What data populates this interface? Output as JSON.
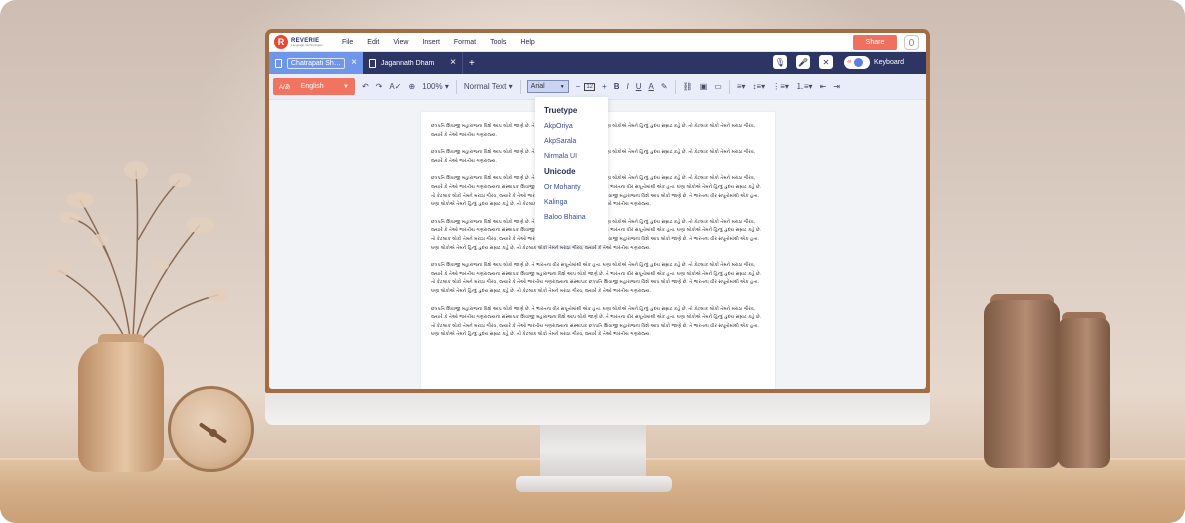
{
  "app": {
    "logo": {
      "name": "REVERIE",
      "tagline": "Language Technologies"
    },
    "menu": [
      "File",
      "Edit",
      "View",
      "Insert",
      "Format",
      "Tools",
      "Help"
    ],
    "share_label": "Share",
    "tabs": [
      {
        "title": "Chatrapati Shiv..",
        "active": true
      },
      {
        "title": "Jagannath Dham",
        "active": false
      }
    ],
    "add_tab_label": "+",
    "keyboard_label": "Keyboard",
    "keyboard_toggle_text": "अ"
  },
  "toolbar": {
    "language": "English",
    "language_icon": "A/あ",
    "zoom": "100%",
    "paragraph_style": "Normal Text",
    "font": "Arial",
    "font_size": "12"
  },
  "font_dropdown": {
    "groups": [
      {
        "label": "Truetype",
        "items": [
          "AkpOriya",
          "AkpSarala",
          "Nirmala UI"
        ]
      },
      {
        "label": "Unicode",
        "items": [
          "Or Mohanty",
          "Kalinga",
          "Baloo Bhaina"
        ]
      }
    ]
  },
  "document": {
    "paragraphs": [
      "છત્રપતિ શિવાજી મહારાજના વિશે આપ લોકો જાણે છે. તે ભારતના વીર સપૂતોમાંથી એક હતા. ઘણા લોકોએ તેમને હિન્દુ હૃદય સમ્રાટ કહે છે. તો કેટલાક લોકો તેમને મરાઠા ગૌરવ, જ્યારે કે તેઓ ભારતીય ગણરાજ્ય.",
      "છત્રપતિ શિવાજી મહારાજના વિશે આપ લોકો જાણે છે. તે ભારતના વીર સપૂતોમાંથી એક હતા. ઘણા લોકોએ તેમને હિન્દુ હૃદય સમ્રાટ કહે છે. તો કેટલાક લોકો તેમને મરાઠા ગૌરવ, જ્યારે કે તેઓ ભારતીય ગણરાજ્ય.",
      "છત્રપતિ શિવાજી મહારાજના વિશે આપ લોકો જાણે છે. તે ભારતના વીર સપૂતોમાંથી એક હતા. ઘણા લોકોએ તેમને હિન્દુ હૃદય સમ્રાટ કહે છે. તો કેટલાક લોકો તેમને મરાઠા ગૌરવ, જ્યારે કે તેઓ ભારતીય ગણરાજ્યના સંસ્થાપક શિવાજી મહારાજના વિશે આપ લોકો જાણે છે. તે ભારતના વીર સપૂતોમાંથી એક હતા. ઘણા લોકોએ તેમને હિન્દુ હૃદય સમ્રાટ કહે છે. તો કેટલાક લોકો તેમને મરાઠા ગૌરવ, જ્યારે કે તેઓ ભારતીય ગણરાજ્યના સંસ્થાપક છત્રપતિ શિવાજી મહારાજના વિશે આપ લોકો જાણે છે. તે ભારતના વીર સપૂતોમાંથી એક હતા. ઘણા લોકોએ તેમને હિન્દુ હૃદય સમ્રાટ કહે છે. તો કેટલાક લોકો તેમને મરાઠા ગૌરવ, જ્યારે કે તેઓ ભારતીય ગણરાજ્ય.",
      "છત્રપતિ શિવાજી મહારાજના વિશે આપ લોકો જાણે છે. તે ભારતના વીર સપૂતોમાંથી એક હતા. ઘણા લોકોએ તેમને હિન્દુ હૃદય સમ્રાટ કહે છે. તો કેટલાક લોકો તેમને મરાઠા ગૌરવ, જ્યારે કે તેઓ ભારતીય ગણરાજ્યના સંસ્થાપક શિવાજી મહારાજના વિશે આપ લોકો જાણે છે. તે ભારતના વીર સપૂતોમાંથી એક હતા. ઘણા લોકોએ તેમને હિન્દુ હૃદય સમ્રાટ કહે છે. તો કેટલાક લોકો તેમને મરાઠા ગૌરવ, જ્યારે કે તેઓ ભારતીય ગણરાજ્યના સંસ્થાપક છત્રપતિ શિવાજી મહારાજના વિશે આપ લોકો જાણે છે. તે ભારતના વીર સપૂતોમાંથી એક હતા. ઘણા લોકોએ તેમને હિન્દુ હૃદય સમ્રાટ કહે છે. તો કેટલાક લોકો તેમને મરાઠા ગૌરવ, જ્યારે કે તેઓ ભારતીય ગણરાજ્ય.",
      "છત્રપતિ શિવાજી મહારાજના વિશે આપ લોકો જાણે છે. તે ભારતના વીર સપૂતોમાંથી એક હતા. ઘણા લોકોએ તેમને હિન્દુ હૃદય સમ્રાટ કહે છે. તો કેટલાક લોકો તેમને મરાઠા ગૌરવ, જ્યારે કે તેઓ ભારતીય ગણરાજ્યના સંસ્થાપક શિવાજી મહારાજના વિશે આપ લોકો જાણે છે. તે ભારતના વીર સપૂતોમાંથી એક હતા. ઘણા લોકોએ તેમને હિન્દુ હૃદય સમ્રાટ કહે છે. તો કેટલાક લોકો તેમને મરાઠા ગૌરવ, જ્યારે કે તેઓ ભારતીય ગણરાજ્યના સંસ્થાપક છત્રપતિ શિવાજી મહારાજના વિશે આપ લોકો જાણે છે. તે ભારતના વીર સપૂતોમાંથી એક હતા. ઘણા લોકોએ તેમને હિન્દુ હૃદય સમ્રાટ કહે છે. તો કેટલાક લોકો તેમને મરાઠા ગૌરવ, જ્યારે કે તેઓ ભારતીય ગણરાજ્ય.",
      "છત્રપતિ શિવાજી મહારાજના વિશે આપ લોકો જાણે છે. તે ભારતના વીર સપૂતોમાંથી એક હતા. ઘણા લોકોએ તેમને હિન્દુ હૃદય સમ્રાટ કહે છે. તો કેટલાક લોકો તેમને મરાઠા ગૌરવ, જ્યારે કે તેઓ ભારતીય ગણરાજ્યના સંસ્થાપક શિવાજી મહારાજના વિશે આપ લોકો જાણે છે. તે ભારતના વીર સપૂતોમાંથી એક હતા. ઘણા લોકોએ તેમને હિન્દુ હૃદય સમ્રાટ કહે છે. તો કેટલાક લોકો તેમને મરાઠા ગૌરવ, જ્યારે કે તેઓ ભારતીય ગણરાજ્યના સંસ્થાપક છત્રપતિ શિવાજી મહારાજના વિશે આપ લોકો જાણે છે. તે ભારતના વીર સપૂતોમાંથી એક હતા. ઘણા લોકોએ તેમને હિન્દુ હૃદય સમ્રાટ કહે છે. તો કેટલાક લોકો તેમને મરાઠા ગૌરવ, જ્યારે કે તેઓ ભારતીય ગણરાજ્ય."
    ]
  },
  "colors": {
    "accent": "#f17461",
    "navy": "#2c3563",
    "active_tab": "#6f96e8",
    "bezel": "#a26d43"
  }
}
